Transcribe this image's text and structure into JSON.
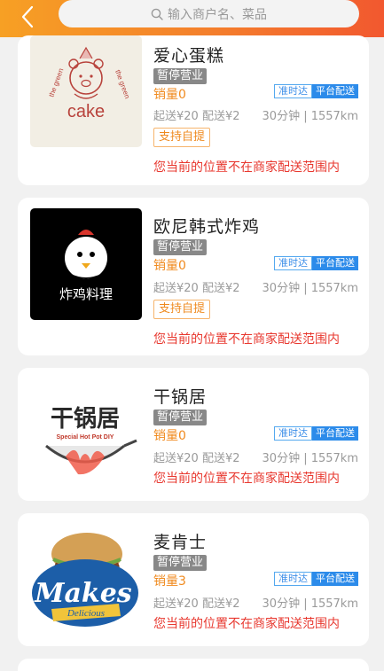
{
  "search": {
    "placeholder": "输入商户名、菜品"
  },
  "icons": {
    "back": "chevron-left-icon",
    "search": "search-icon"
  },
  "colors": {
    "header_start": "#f7a024",
    "header_end": "#f2582f",
    "sales": "#f08a1e",
    "warning": "#e8382f",
    "delivery_blue": "#2c8bea",
    "paused_gray": "#888888"
  },
  "stores": [
    {
      "name": "爱心蛋糕",
      "status": "暂停营业",
      "sales": "销量0",
      "tag_ontime": "准时达",
      "tag_platform": "平台配送",
      "fees": "起送¥20 配送¥2",
      "time_distance": "30分钟 | 1557km",
      "pickup": "支持自提",
      "notice": "您当前的位置不在商家配送范围内",
      "logo_text": "cake",
      "logo_ring_text": "the green"
    },
    {
      "name": "欧尼韩式炸鸡",
      "status": "暂停营业",
      "sales": "销量0",
      "tag_ontime": "准时达",
      "tag_platform": "平台配送",
      "fees": "起送¥20 配送¥2",
      "time_distance": "30分钟 | 1557km",
      "pickup": "支持自提",
      "notice": "您当前的位置不在商家配送范围内",
      "logo_text": "炸鸡料理"
    },
    {
      "name": "干锅居",
      "status": "暂停营业",
      "sales": "销量0",
      "tag_ontime": "准时达",
      "tag_platform": "平台配送",
      "fees": "起送¥20 配送¥2",
      "time_distance": "30分钟 | 1557km",
      "notice": "您当前的位置不在商家配送范围内",
      "logo_text": "干锅居",
      "logo_sub": "Special Hot Pot DIY"
    },
    {
      "name": "麦肯士",
      "status": "暂停营业",
      "sales": "销量3",
      "tag_ontime": "准时达",
      "tag_platform": "平台配送",
      "fees": "起送¥20 配送¥2",
      "time_distance": "30分钟 | 1557km",
      "notice": "您当前的位置不在商家配送范围内",
      "logo_text": "Makes",
      "logo_sub": "Delicious"
    }
  ]
}
